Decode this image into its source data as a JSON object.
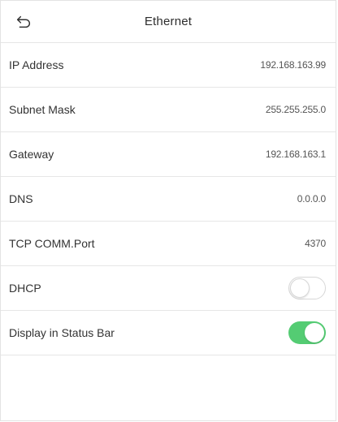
{
  "header": {
    "title": "Ethernet",
    "back_icon": "back-arrow-icon"
  },
  "rows": [
    {
      "label": "IP Address",
      "value": "192.168.163.99"
    },
    {
      "label": "Subnet Mask",
      "value": "255.255.255.0"
    },
    {
      "label": "Gateway",
      "value": "192.168.163.1"
    },
    {
      "label": "DNS",
      "value": "0.0.0.0"
    },
    {
      "label": "TCP COMM.Port",
      "value": "4370"
    }
  ],
  "toggles": [
    {
      "label": "DHCP",
      "state": "off"
    },
    {
      "label": "Display in Status Bar",
      "state": "on"
    }
  ],
  "colors": {
    "toggle_on": "#54cc73",
    "toggle_off_border": "#d7d7d7",
    "divider": "#e6e6e6"
  }
}
